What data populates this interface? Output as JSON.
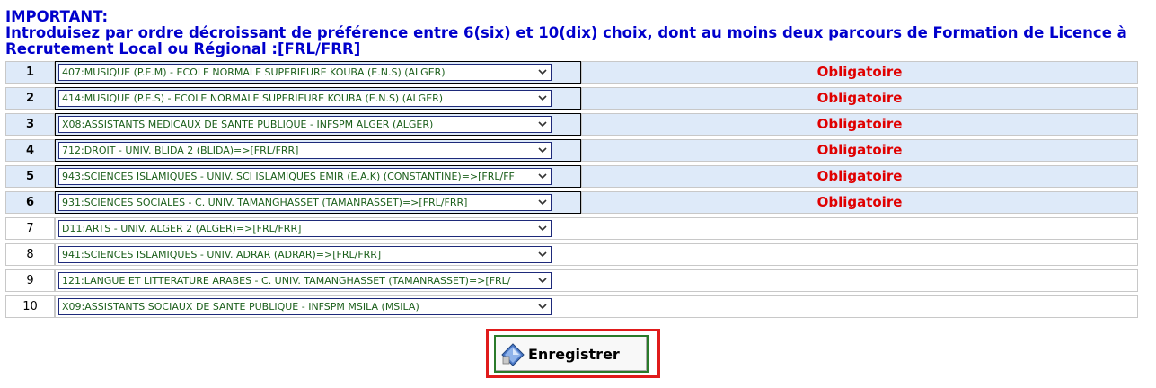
{
  "header": {
    "line1": "IMPORTANT:",
    "line2": "Introduisez par ordre décroissant de préférence entre 6(six) et 10(dix) choix, dont au moins deux parcours de Formation de Licence à",
    "line3": "Recrutement Local ou Régional :[FRL/FRR]"
  },
  "choices": [
    {
      "num": "1",
      "value": "407:MUSIQUE (P.E.M) - ECOLE NORMALE SUPERIEURE KOUBA (E.N.S) (ALGER)",
      "status": "Obligatoire",
      "required": true
    },
    {
      "num": "2",
      "value": "414:MUSIQUE (P.E.S) - ECOLE NORMALE SUPERIEURE KOUBA (E.N.S) (ALGER)",
      "status": "Obligatoire",
      "required": true
    },
    {
      "num": "3",
      "value": "X08:ASSISTANTS MEDICAUX DE SANTE PUBLIQUE - INFSPM ALGER (ALGER)",
      "status": "Obligatoire",
      "required": true
    },
    {
      "num": "4",
      "value": "712:DROIT - UNIV. BLIDA 2 (BLIDA)=>[FRL/FRR]",
      "status": "Obligatoire",
      "required": true
    },
    {
      "num": "5",
      "value": "943:SCIENCES ISLAMIQUES - UNIV. SCI ISLAMIQUES EMIR (E.A.K) (CONSTANTINE)=>[FRL/FF",
      "status": "Obligatoire",
      "required": true
    },
    {
      "num": "6",
      "value": "931:SCIENCES SOCIALES - C. UNIV. TAMANGHASSET (TAMANRASSET)=>[FRL/FRR]",
      "status": "Obligatoire",
      "required": true
    },
    {
      "num": "7",
      "value": "D11:ARTS - UNIV. ALGER 2 (ALGER)=>[FRL/FRR]",
      "status": "",
      "required": false
    },
    {
      "num": "8",
      "value": "941:SCIENCES ISLAMIQUES - UNIV. ADRAR (ADRAR)=>[FRL/FRR]",
      "status": "",
      "required": false
    },
    {
      "num": "9",
      "value": "121:LANGUE ET LITTERATURE ARABES - C. UNIV. TAMANGHASSET (TAMANRASSET)=>[FRL/",
      "status": "",
      "required": false
    },
    {
      "num": "10",
      "value": "X09:ASSISTANTS SOCIAUX DE SANTE PUBLIQUE - INFSPM MSILA (MSILA)",
      "status": "",
      "required": false
    }
  ],
  "save_button": {
    "label": "Enregistrer",
    "icon": "diamond-save-icon"
  },
  "colors": {
    "header": "#0000cc",
    "required_bg": "#deeaf9",
    "obligatoire": "#e00000",
    "select_text": "#1a5e1a",
    "highlight": "#e01b1b"
  }
}
